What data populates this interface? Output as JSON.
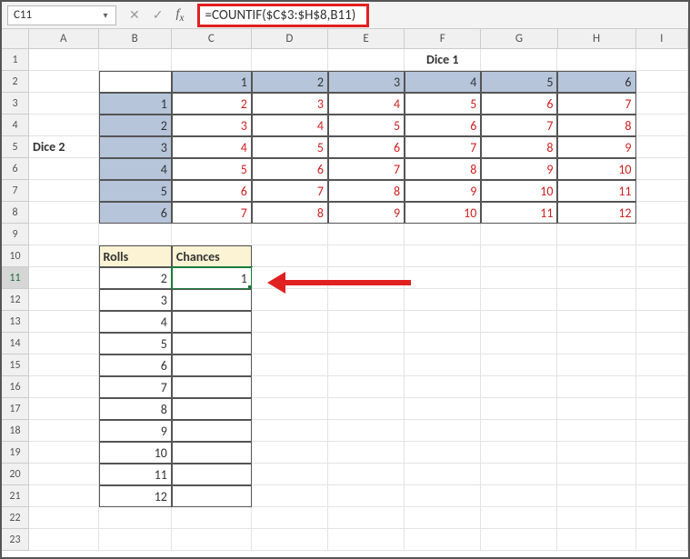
{
  "namebox": {
    "value": "C11"
  },
  "formula": {
    "text": "=COUNTIF($C$3:$H$8,B11)"
  },
  "columns": [
    "A",
    "B",
    "C",
    "D",
    "E",
    "F",
    "G",
    "H",
    "I"
  ],
  "rows": [
    "1",
    "2",
    "3",
    "4",
    "5",
    "6",
    "7",
    "8",
    "9",
    "10",
    "11",
    "12",
    "13",
    "14",
    "15",
    "16",
    "17",
    "18",
    "19",
    "20",
    "21",
    "22",
    "23"
  ],
  "labels": {
    "dice1": "Dice 1",
    "dice2": "Dice 2",
    "rolls": "Rolls",
    "chances": "Chances"
  },
  "dice": {
    "col_headers": [
      "1",
      "2",
      "3",
      "4",
      "5",
      "6"
    ],
    "row_headers": [
      "1",
      "2",
      "3",
      "4",
      "5",
      "6"
    ],
    "grid": [
      [
        "2",
        "3",
        "4",
        "5",
        "6",
        "7"
      ],
      [
        "3",
        "4",
        "5",
        "6",
        "7",
        "8"
      ],
      [
        "4",
        "5",
        "6",
        "7",
        "8",
        "9"
      ],
      [
        "5",
        "6",
        "7",
        "8",
        "9",
        "10"
      ],
      [
        "6",
        "7",
        "8",
        "9",
        "10",
        "11"
      ],
      [
        "7",
        "8",
        "9",
        "10",
        "11",
        "12"
      ]
    ]
  },
  "rolls_table": {
    "rolls": [
      "2",
      "3",
      "4",
      "5",
      "6",
      "7",
      "8",
      "9",
      "10",
      "11",
      "12"
    ],
    "chances": [
      "1",
      "",
      "",
      "",
      "",
      "",
      "",
      "",
      "",
      "",
      ""
    ]
  },
  "chart_data": {
    "type": "table",
    "title": "Dice sum grid and roll chances",
    "tables": [
      {
        "name": "dice_sums",
        "row_labels": [
          1,
          2,
          3,
          4,
          5,
          6
        ],
        "col_labels": [
          1,
          2,
          3,
          4,
          5,
          6
        ],
        "values": [
          [
            2,
            3,
            4,
            5,
            6,
            7
          ],
          [
            3,
            4,
            5,
            6,
            7,
            8
          ],
          [
            4,
            5,
            6,
            7,
            8,
            9
          ],
          [
            5,
            6,
            7,
            8,
            9,
            10
          ],
          [
            6,
            7,
            8,
            9,
            10,
            11
          ],
          [
            7,
            8,
            9,
            10,
            11,
            12
          ]
        ]
      },
      {
        "name": "roll_chances",
        "columns": [
          "Rolls",
          "Chances"
        ],
        "rows": [
          [
            2,
            1
          ],
          [
            3,
            null
          ],
          [
            4,
            null
          ],
          [
            5,
            null
          ],
          [
            6,
            null
          ],
          [
            7,
            null
          ],
          [
            8,
            null
          ],
          [
            9,
            null
          ],
          [
            10,
            null
          ],
          [
            11,
            null
          ],
          [
            12,
            null
          ]
        ]
      }
    ]
  }
}
